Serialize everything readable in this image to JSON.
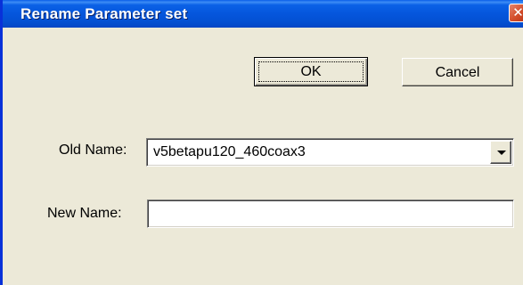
{
  "window": {
    "title": "Rename Parameter set",
    "close_glyph": "✕"
  },
  "buttons": {
    "ok_label": "OK",
    "cancel_label": "Cancel"
  },
  "fields": {
    "old_name_label": "Old Name:",
    "old_name_value": "v5betapu120_460coax3",
    "new_name_label": "New Name:",
    "new_name_value": ""
  },
  "icons": {
    "close": "close-icon",
    "dropdown": "chevron-down-icon"
  },
  "colors": {
    "titlebar": "#0556dc",
    "dialog_bg": "#ece9d8",
    "close_button": "#d5502d"
  }
}
